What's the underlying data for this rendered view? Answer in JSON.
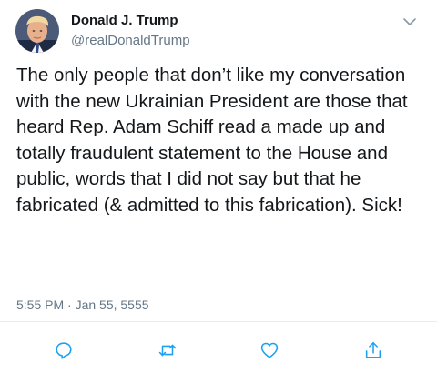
{
  "tweet": {
    "author_name": "Donald J. Trump",
    "author_handle": "@realDonaldTrump",
    "body": "The only people that don’t like my conversation with the new Ukrainian President are those that heard Rep. Adam Schiff read a made up and totally fraudulent statement to the House and public, words that I did not say but that he fabricated (& admitted to this fabrication). Sick!",
    "timestamp": "5:55 PM · Jan 55, 5555"
  },
  "actions": [
    {
      "icon": "reply-icon"
    },
    {
      "icon": "retweet-icon"
    },
    {
      "icon": "like-icon"
    },
    {
      "icon": "share-icon"
    }
  ],
  "colors": {
    "text": "#14171a",
    "secondary": "#657786",
    "icon": "#1da1f2",
    "divider": "#e6ecf0"
  }
}
